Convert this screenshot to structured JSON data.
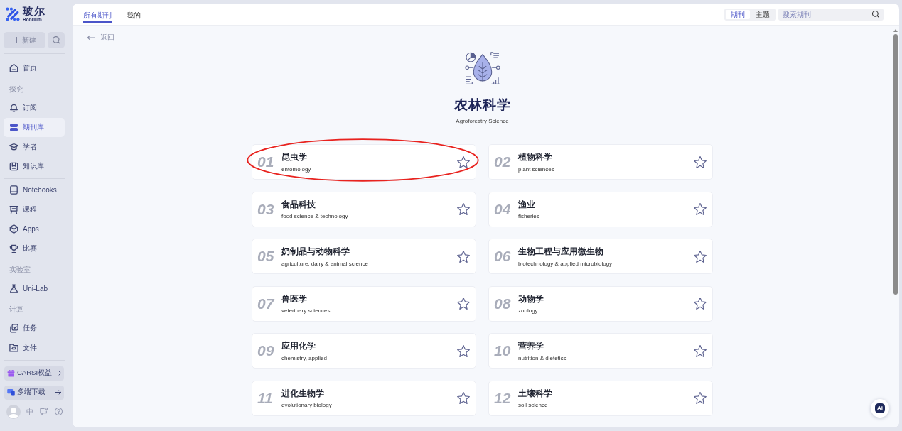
{
  "sidebar": {
    "logo": {
      "name": "玻尔",
      "tagline": "Bohrium"
    },
    "new_button": {
      "label": "新建"
    },
    "sections": [
      {
        "items": [
          {
            "kind": "link",
            "label": "首页",
            "selected": false
          },
          {
            "kind": "heading",
            "label": "探究"
          },
          {
            "kind": "link",
            "label": "订阅",
            "selected": false
          },
          {
            "kind": "link",
            "label": "期刊库",
            "selected": true
          },
          {
            "kind": "link",
            "label": "学者",
            "selected": false
          },
          {
            "kind": "link",
            "label": "知识库",
            "selected": false
          }
        ]
      },
      {
        "items": [
          {
            "kind": "link",
            "label": "Notebooks",
            "selected": false
          },
          {
            "kind": "link",
            "label": "课程",
            "selected": false
          },
          {
            "kind": "link",
            "label": "Apps",
            "selected": false
          },
          {
            "kind": "link",
            "label": "比赛",
            "selected": false
          },
          {
            "kind": "heading",
            "label": "实验室"
          },
          {
            "kind": "link",
            "label": "Uni-Lab",
            "selected": false
          },
          {
            "kind": "heading",
            "label": "计算"
          },
          {
            "kind": "link",
            "label": "任务",
            "selected": false
          },
          {
            "kind": "link",
            "label": "文件",
            "selected": false
          }
        ]
      }
    ],
    "promos": [
      {
        "label": "CARSI权益"
      },
      {
        "label": "多端下载"
      }
    ],
    "footer": {
      "language": "中"
    }
  },
  "header": {
    "tabs": [
      {
        "label": "所有期刊",
        "selected": true
      },
      {
        "label": "我的",
        "selected": false
      }
    ],
    "search_mode": [
      {
        "label": "期刊",
        "selected": true
      },
      {
        "label": "主题",
        "selected": false
      }
    ],
    "search": {
      "placeholder": "搜索期刊"
    }
  },
  "back_link": {
    "label": "返回"
  },
  "category": {
    "title": "农林科学",
    "subtitle": "Agroforestry Science"
  },
  "journals": [
    {
      "number": "01",
      "title": "昆虫学",
      "subtitle": "entomology",
      "favorited": false,
      "highlighted": true
    },
    {
      "number": "02",
      "title": "植物科学",
      "subtitle": "plant sciences",
      "favorited": false,
      "highlighted": false
    },
    {
      "number": "03",
      "title": "食品科技",
      "subtitle": "food science & technology",
      "favorited": false,
      "highlighted": false
    },
    {
      "number": "04",
      "title": "渔业",
      "subtitle": "fisheries",
      "favorited": false,
      "highlighted": false
    },
    {
      "number": "05",
      "title": "奶制品与动物科学",
      "subtitle": "agriculture, dairy & animal science",
      "favorited": false,
      "highlighted": false
    },
    {
      "number": "06",
      "title": "生物工程与应用微生物",
      "subtitle": "biotechnology & applied microbiology",
      "favorited": false,
      "highlighted": false
    },
    {
      "number": "07",
      "title": "兽医学",
      "subtitle": "veterinary sciences",
      "favorited": false,
      "highlighted": false
    },
    {
      "number": "08",
      "title": "动物学",
      "subtitle": "zoology",
      "favorited": false,
      "highlighted": false
    },
    {
      "number": "09",
      "title": "应用化学",
      "subtitle": "chemistry, applied",
      "favorited": false,
      "highlighted": false
    },
    {
      "number": "10",
      "title": "营养学",
      "subtitle": "nutrition & dietetics",
      "favorited": false,
      "highlighted": false
    },
    {
      "number": "11",
      "title": "进化生物学",
      "subtitle": "evolutionary biology",
      "favorited": false,
      "highlighted": false
    },
    {
      "number": "12",
      "title": "土壤科学",
      "subtitle": "soil science",
      "favorited": false,
      "highlighted": false
    }
  ],
  "assistant_button": {
    "label": "Ai"
  }
}
